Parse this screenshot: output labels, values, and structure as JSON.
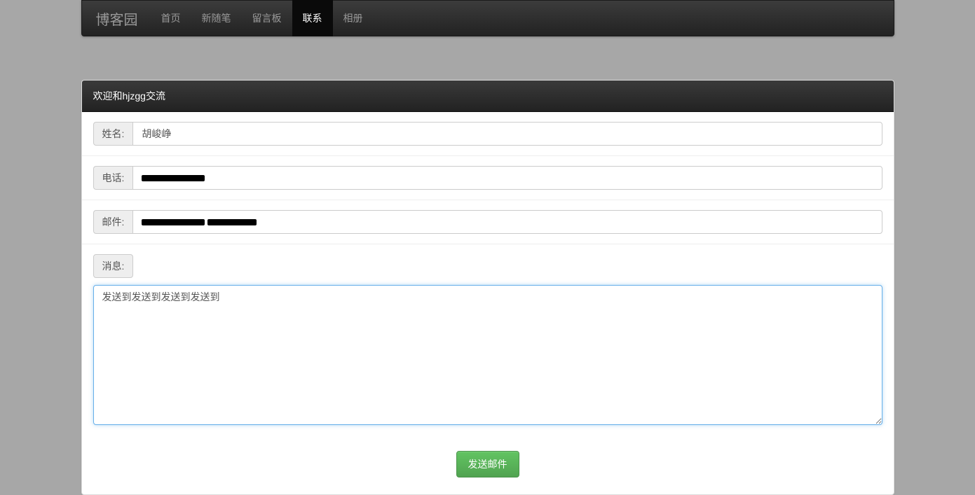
{
  "nav": {
    "brand": "博客园",
    "items": [
      {
        "label": "首页",
        "active": false
      },
      {
        "label": "新随笔",
        "active": false
      },
      {
        "label": "留言板",
        "active": false
      },
      {
        "label": "联系",
        "active": true
      },
      {
        "label": "相册",
        "active": false
      }
    ]
  },
  "panel": {
    "heading": "欢迎和hjzgg交流"
  },
  "form": {
    "name_label": "姓名:",
    "name_value": "胡峻峥",
    "phone_label": "电话:",
    "phone_value": "",
    "email_label": "邮件:",
    "email_value": "",
    "message_label": "消息:",
    "message_value": "发送到发送到发送到发送到",
    "submit_label": "发送邮件"
  }
}
